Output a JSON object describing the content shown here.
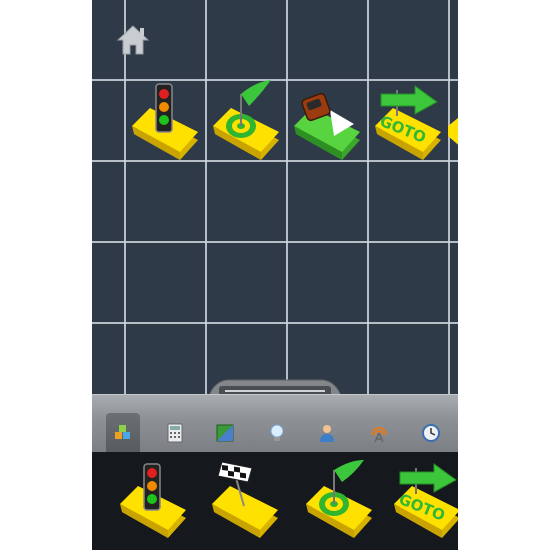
{
  "app": {
    "home_icon": "home-icon",
    "canvas_tiles": [
      {
        "name": "traffic-light-block",
        "icon": "traffic-light-icon"
      },
      {
        "name": "target-flag-block",
        "icon": "target-flag-icon"
      },
      {
        "name": "drive-car-block",
        "icon": "car-icon"
      },
      {
        "name": "goto-block",
        "icon": "goto-arrow-icon",
        "label": "GOTO"
      }
    ],
    "toolbar": {
      "active_tab": "blocks",
      "tabs": [
        {
          "name": "blocks",
          "icon": "cubes-icon"
        },
        {
          "name": "calculator",
          "icon": "calculator-icon"
        },
        {
          "name": "map",
          "icon": "map-icon"
        },
        {
          "name": "ideas",
          "icon": "lightbulb-icon"
        },
        {
          "name": "person",
          "icon": "person-icon"
        },
        {
          "name": "signal",
          "icon": "signal-antenna-icon"
        },
        {
          "name": "clock",
          "icon": "clock-icon"
        }
      ]
    },
    "tray_tiles": [
      {
        "name": "traffic-light-block",
        "icon": "traffic-light-icon"
      },
      {
        "name": "checkered-flag-block",
        "icon": "checkered-flag-icon"
      },
      {
        "name": "target-flag-block",
        "icon": "target-flag-icon"
      },
      {
        "name": "goto-block",
        "icon": "goto-arrow-icon",
        "label": "GOTO"
      }
    ],
    "colors": {
      "grid_background": "#2e3a47",
      "tile_yellow": "#ffe100",
      "tile_green": "#57d43f",
      "tray_background": "#15181c"
    }
  }
}
